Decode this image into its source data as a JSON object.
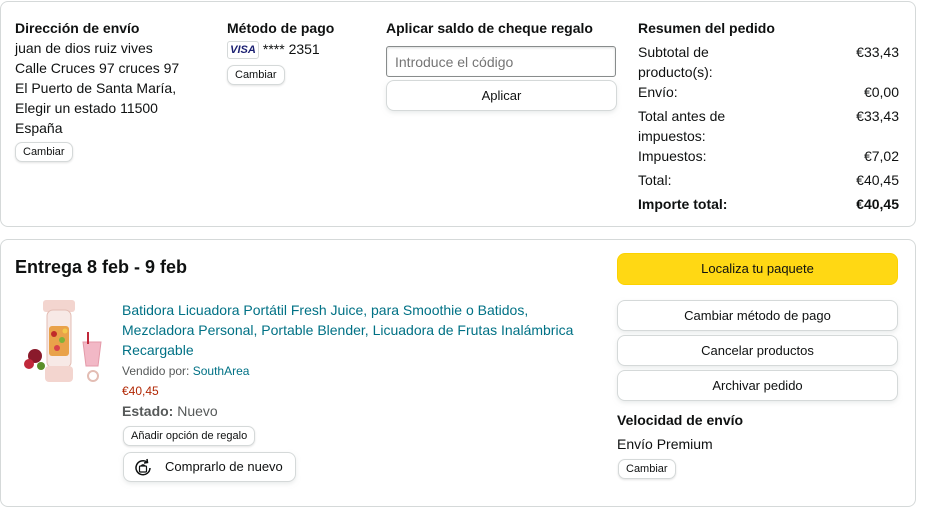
{
  "shipping": {
    "title": "Dirección de envío",
    "lines": [
      "juan de dios ruiz vives",
      "Calle Cruces 97 cruces 97",
      "El Puerto de Santa María,",
      "Elegir un estado 11500",
      "España"
    ],
    "change_label": "Cambiar"
  },
  "payment": {
    "title": "Método de pago",
    "card_brand": "VISA",
    "card_masked": "**** 2351",
    "change_label": "Cambiar"
  },
  "gift": {
    "title": "Aplicar saldo de cheque regalo",
    "placeholder": "Introduce el código",
    "apply_label": "Aplicar"
  },
  "summary": {
    "title": "Resumen del pedido",
    "rows": [
      {
        "label": "Subtotal de producto(s):",
        "value": "€33,43"
      },
      {
        "label": "Envío:",
        "value": "€0,00"
      },
      {
        "label": "Total antes de impuestos:",
        "value": "€33,43"
      },
      {
        "label": "Impuestos:",
        "value": "€7,02"
      },
      {
        "label": "Total:",
        "value": "€40,45"
      },
      {
        "label": "Importe total:",
        "value": "€40,45"
      }
    ]
  },
  "delivery": {
    "title": "Entrega 8 feb - 9 feb",
    "product": {
      "name": "Batidora Licuadora Portátil Fresh Juice, para Smoothie o Batidos, Mezcladora Personal, Portable Blender, Licuadora de Frutas Inalámbrica Recargable",
      "sold_by_label": "Vendido por:",
      "seller": "SouthArea",
      "price": "€40,45",
      "condition_label": "Estado:",
      "condition": "Nuevo",
      "gift_option_label": "Añadir opción de regalo",
      "buy_again_label": "Comprarlo de nuevo"
    },
    "actions": {
      "track": "Localiza tu paquete",
      "change_payment": "Cambiar método de pago",
      "cancel": "Cancelar productos",
      "archive": "Archivar pedido"
    },
    "speed": {
      "title": "Velocidad de envío",
      "value": "Envío Premium",
      "change_label": "Cambiar"
    }
  },
  "colors": {
    "accent_yellow": "#ffd814",
    "link": "#007185",
    "price": "#b12704"
  }
}
